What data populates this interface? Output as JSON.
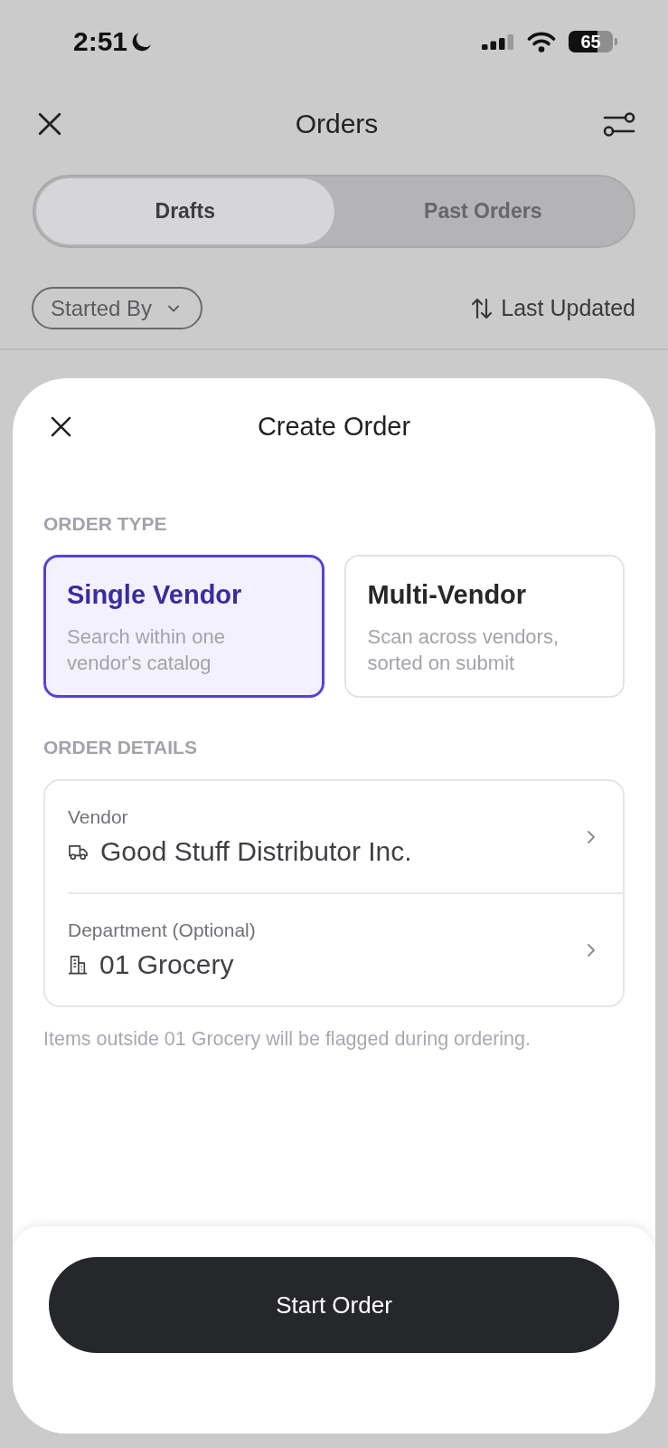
{
  "status_bar": {
    "time": "2:51",
    "battery": "65"
  },
  "header": {
    "title": "Orders"
  },
  "tabs": [
    {
      "label": "Drafts",
      "selected": true
    },
    {
      "label": "Past Orders",
      "selected": false
    }
  ],
  "filter_bar": {
    "started_by": "Started By",
    "sort": "Last Updated"
  },
  "sheet": {
    "title": "Create Order",
    "order_type": {
      "heading": "ORDER TYPE",
      "options": [
        {
          "title": "Single Vendor",
          "description": "Search within one vendor's catalog",
          "selected": true
        },
        {
          "title": "Multi-Vendor",
          "description": "Scan across vendors, sorted on submit",
          "selected": false
        }
      ]
    },
    "order_details": {
      "heading": "ORDER DETAILS",
      "rows": [
        {
          "kind": "vendor",
          "label": "Vendor",
          "value": "Good Stuff Distributor Inc."
        },
        {
          "kind": "department",
          "label": "Department (Optional)",
          "value": "01 Grocery"
        }
      ],
      "note": "Items outside 01 Grocery will be flagged during ordering."
    },
    "button": "Start Order"
  }
}
